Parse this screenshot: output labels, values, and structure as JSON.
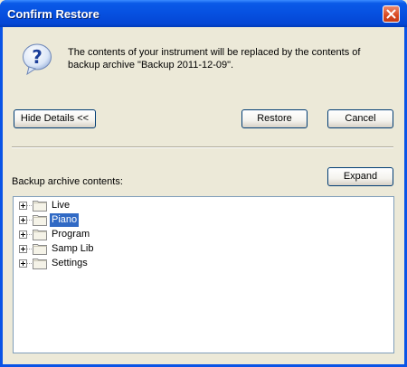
{
  "window": {
    "title": "Confirm Restore"
  },
  "message": {
    "line1": "The contents of your instrument will be replaced by the contents of",
    "line2": "backup archive \"Backup 2011-12-09\".",
    "icon": "question-icon"
  },
  "buttons": {
    "hide_details": "Hide Details <<",
    "restore": "Restore",
    "cancel": "Cancel",
    "expand": "Expand"
  },
  "archive": {
    "label": "Backup archive contents:",
    "items": [
      {
        "label": "Live",
        "selected": false
      },
      {
        "label": "Piano",
        "selected": true
      },
      {
        "label": "Program",
        "selected": false
      },
      {
        "label": "Samp Lib",
        "selected": false
      },
      {
        "label": "Settings",
        "selected": false
      }
    ]
  },
  "colors": {
    "titlebar": "#0650e0",
    "selection": "#316ac5",
    "dialog_bg": "#ece9d8",
    "folder": "#f5f3e8"
  }
}
